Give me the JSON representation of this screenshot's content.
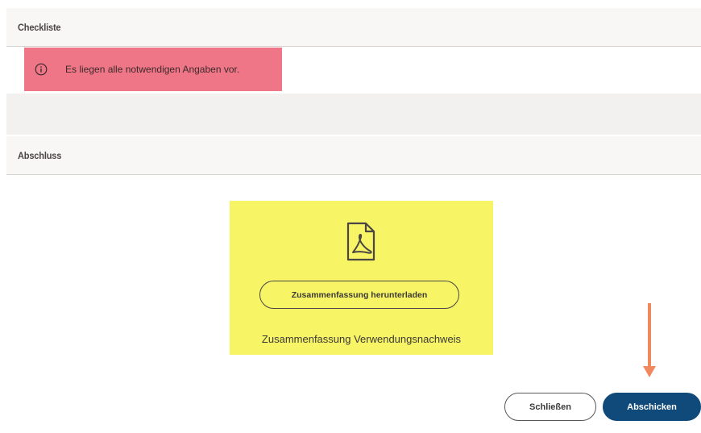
{
  "checklist": {
    "title": "Checkliste",
    "alert_message": "Es liegen alle notwendigen Angaben vor.",
    "alert_icon": "info-circle-icon",
    "alert_color": "#ef7686"
  },
  "completion": {
    "title": "Abschluss",
    "document": {
      "icon": "pdf-file-icon",
      "download_label": "Zusammenfassung herunterladen",
      "caption": "Zusammenfassung Verwendungsnachweis",
      "highlight_color": "#f7f466"
    }
  },
  "annotation": {
    "icon": "arrow-down-icon",
    "color": "#f0895e"
  },
  "footer": {
    "close_label": "Schließen",
    "submit_label": "Abschicken",
    "submit_color": "#104a7a"
  }
}
